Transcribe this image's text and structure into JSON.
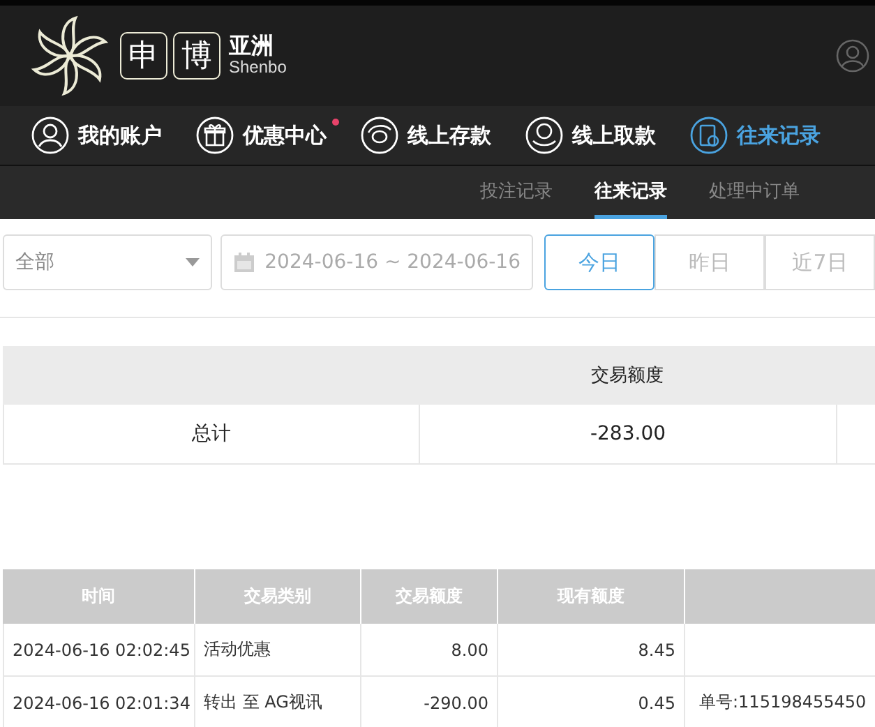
{
  "brand": {
    "mark_1": "申",
    "mark_2": "博",
    "name": "亚洲",
    "latin": "Shenbo"
  },
  "nav": [
    {
      "label": "我的账户",
      "kind": "user",
      "dot": false,
      "selected": false
    },
    {
      "label": "优惠中心",
      "kind": "gift",
      "dot": true,
      "selected": false
    },
    {
      "label": "线上存款",
      "kind": "deposit",
      "dot": false,
      "selected": false
    },
    {
      "label": "线上取款",
      "kind": "withdraw",
      "dot": false,
      "selected": false
    },
    {
      "label": "往来记录",
      "kind": "record",
      "dot": false,
      "selected": true
    }
  ],
  "subtabs": [
    {
      "label": "投注记录",
      "selected": false
    },
    {
      "label": "往来记录",
      "selected": true
    },
    {
      "label": "处理中订单",
      "selected": false
    }
  ],
  "filter": {
    "type_value": "全部",
    "date_range": "2024-06-16 ~ 2024-06-16",
    "ranges": [
      {
        "label": "今日",
        "selected": true
      },
      {
        "label": "昨日",
        "selected": false
      },
      {
        "label": "近7日",
        "selected": false
      }
    ]
  },
  "summary": {
    "column_2": "交易额度",
    "row_label": "总计",
    "amount": "-283.00"
  },
  "records": {
    "columns": [
      "时间",
      "交易类别",
      "交易额度",
      "现有额度"
    ],
    "rows": [
      {
        "time": "2024-06-16 02:02:45",
        "category": "活动优惠",
        "amount": "8.00",
        "balance": "8.45",
        "note": ""
      },
      {
        "time": "2024-06-16 02:01:34",
        "category": "转出 至 AG视讯",
        "amount": "-290.00",
        "balance": "0.45",
        "note": "单号:115198455450"
      }
    ]
  }
}
